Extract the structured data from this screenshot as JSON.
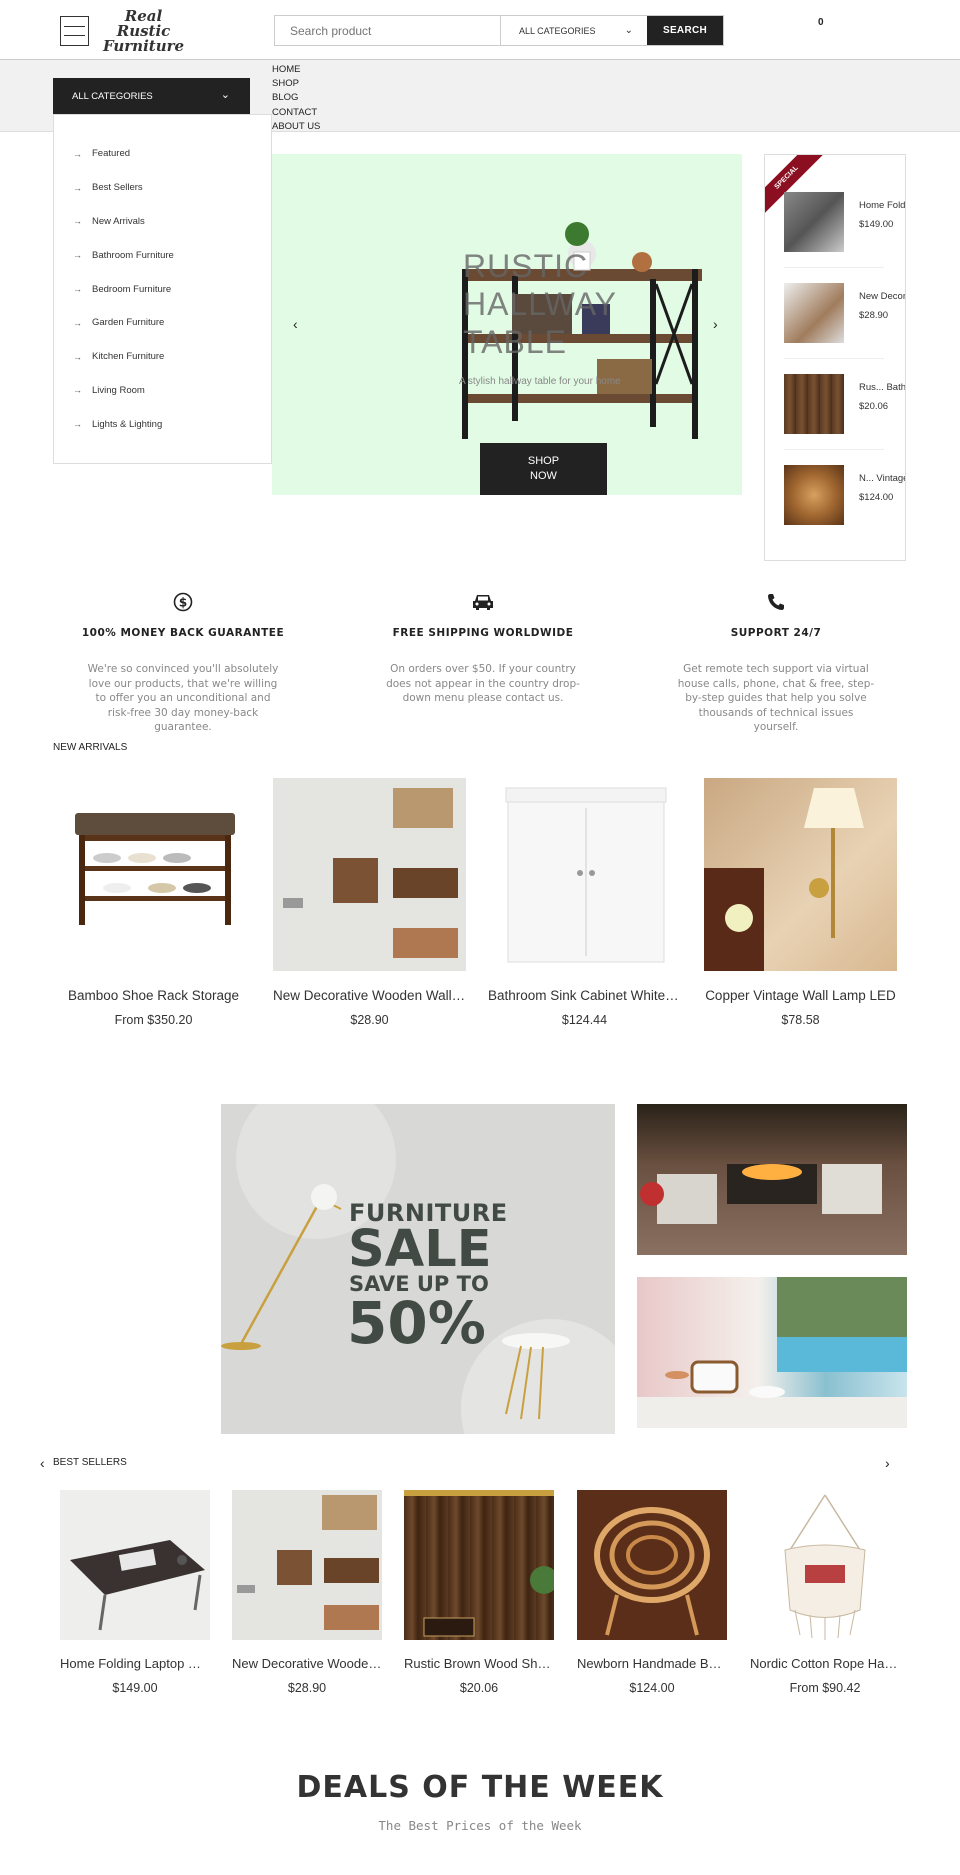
{
  "header": {
    "logo_line1": "Real Rustic",
    "logo_line2": "Furniture",
    "search_placeholder": "Search product",
    "category_select": "ALL CATEGORIES",
    "search_button": "SEARCH",
    "cart_count": "0"
  },
  "nav": {
    "all_categories": "ALL CATEGORIES",
    "menu": [
      "HOME",
      "SHOP",
      "BLOG",
      "CONTACT",
      "ABOUT US"
    ],
    "categories": [
      "Featured",
      "Best Sellers",
      "New Arrivals",
      "Bathroom Furniture",
      "Bedroom Furniture",
      "Garden Furniture",
      "Kitchen Furniture",
      "Living Room",
      "Lights & Lighting"
    ]
  },
  "slider": {
    "title_lines": [
      "RUSTIC",
      "HALLWAY",
      "TABLE"
    ],
    "subtitle": "A stylish hallway table for your home",
    "button_line1": "SHOP",
    "button_line2": "NOW",
    "prev": "‹",
    "next": "›",
    "background": "#e2fbe4"
  },
  "special": {
    "badge": "SPECIAL",
    "items": [
      {
        "name": "Home Foldi...   Bed",
        "price": "$149.00"
      },
      {
        "name": "New Decorative",
        "price": "$28.90"
      },
      {
        "name": "Rus...   Bath Curtain",
        "price": "$20.06"
      },
      {
        "name": "N...   Vintage Chair",
        "price": "$124.00"
      }
    ]
  },
  "features": [
    {
      "icon": "dollar-icon",
      "title": "100% MONEY BACK GUARANTEE",
      "text": "We're so convinced you'll absolutely love our products, that we're willing to offer you an unconditional and risk-free 30 day money-back guarantee."
    },
    {
      "icon": "car-icon",
      "title": "FREE SHIPPING WORLDWIDE",
      "text": "On orders over $50. If your country does not appear in the country drop-down menu please contact us."
    },
    {
      "icon": "phone-icon",
      "title": "SUPPORT 24/7",
      "text": "Get remote tech support via virtual house calls, phone, chat & free, step-by-step guides that help you solve thousands of technical issues yourself."
    }
  ],
  "new_arrivals": {
    "title": "NEW ARRIVALS",
    "products": [
      {
        "name": "Bamboo Shoe Rack Storage",
        "price": "From $350.20"
      },
      {
        "name": "New Decorative Wooden Wall Key Holder",
        "price": "$28.90"
      },
      {
        "name": "Bathroom Sink Cabinet White wood",
        "price": "$124.44"
      },
      {
        "name": "Copper Vintage Wall Lamp LED",
        "price": "$78.58"
      }
    ]
  },
  "sale_banner": {
    "line1": "FURNITURE",
    "line2": "SALE",
    "line3": "SAVE UP TO",
    "line4": "50%"
  },
  "best_sellers": {
    "title": "BEST SELLERS",
    "prev": "‹",
    "next": "›",
    "products": [
      {
        "name": "Home Folding Laptop Desk Bed",
        "price": "$149.00"
      },
      {
        "name": "New Decorative Wooden Wall Key Holder",
        "price": "$28.90"
      },
      {
        "name": "Rustic Brown Wood Shower Curtain",
        "price": "$20.06"
      },
      {
        "name": "Newborn Handmade Bamboo Chair",
        "price": "$124.00"
      },
      {
        "name": "Nordic Cotton Rope Hammock Chair",
        "price": "From $90.42"
      }
    ]
  },
  "deals": {
    "title": "DEALS OF THE WEEK",
    "subtitle": "The Best Prices of the Week"
  }
}
